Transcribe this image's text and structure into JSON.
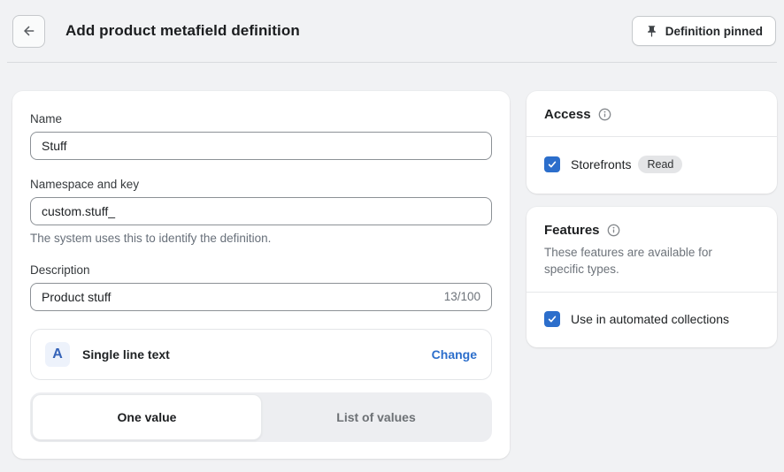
{
  "header": {
    "title": "Add product metafield definition",
    "pinned_label": "Definition pinned"
  },
  "form": {
    "name": {
      "label": "Name",
      "value": "Stuff"
    },
    "namespace": {
      "label": "Namespace and key",
      "value": "custom.stuff_",
      "help": "The system uses this to identify the definition."
    },
    "description": {
      "label": "Description",
      "value": "Product stuff",
      "counter": "13/100"
    },
    "type": {
      "icon_letter": "A",
      "label": "Single line text",
      "change_label": "Change"
    },
    "tabs": [
      {
        "label": "One value",
        "active": true
      },
      {
        "label": "List of values",
        "active": false
      }
    ]
  },
  "access": {
    "title": "Access",
    "items": [
      {
        "label": "Storefronts",
        "badge": "Read",
        "checked": true
      }
    ]
  },
  "features": {
    "title": "Features",
    "description": "These features are available for specific types.",
    "items": [
      {
        "label": "Use in automated collections",
        "checked": true
      }
    ]
  },
  "colors": {
    "accent": "#2c6ecb",
    "link": "#2c6ecb",
    "page-bg": "#f1f2f4"
  }
}
